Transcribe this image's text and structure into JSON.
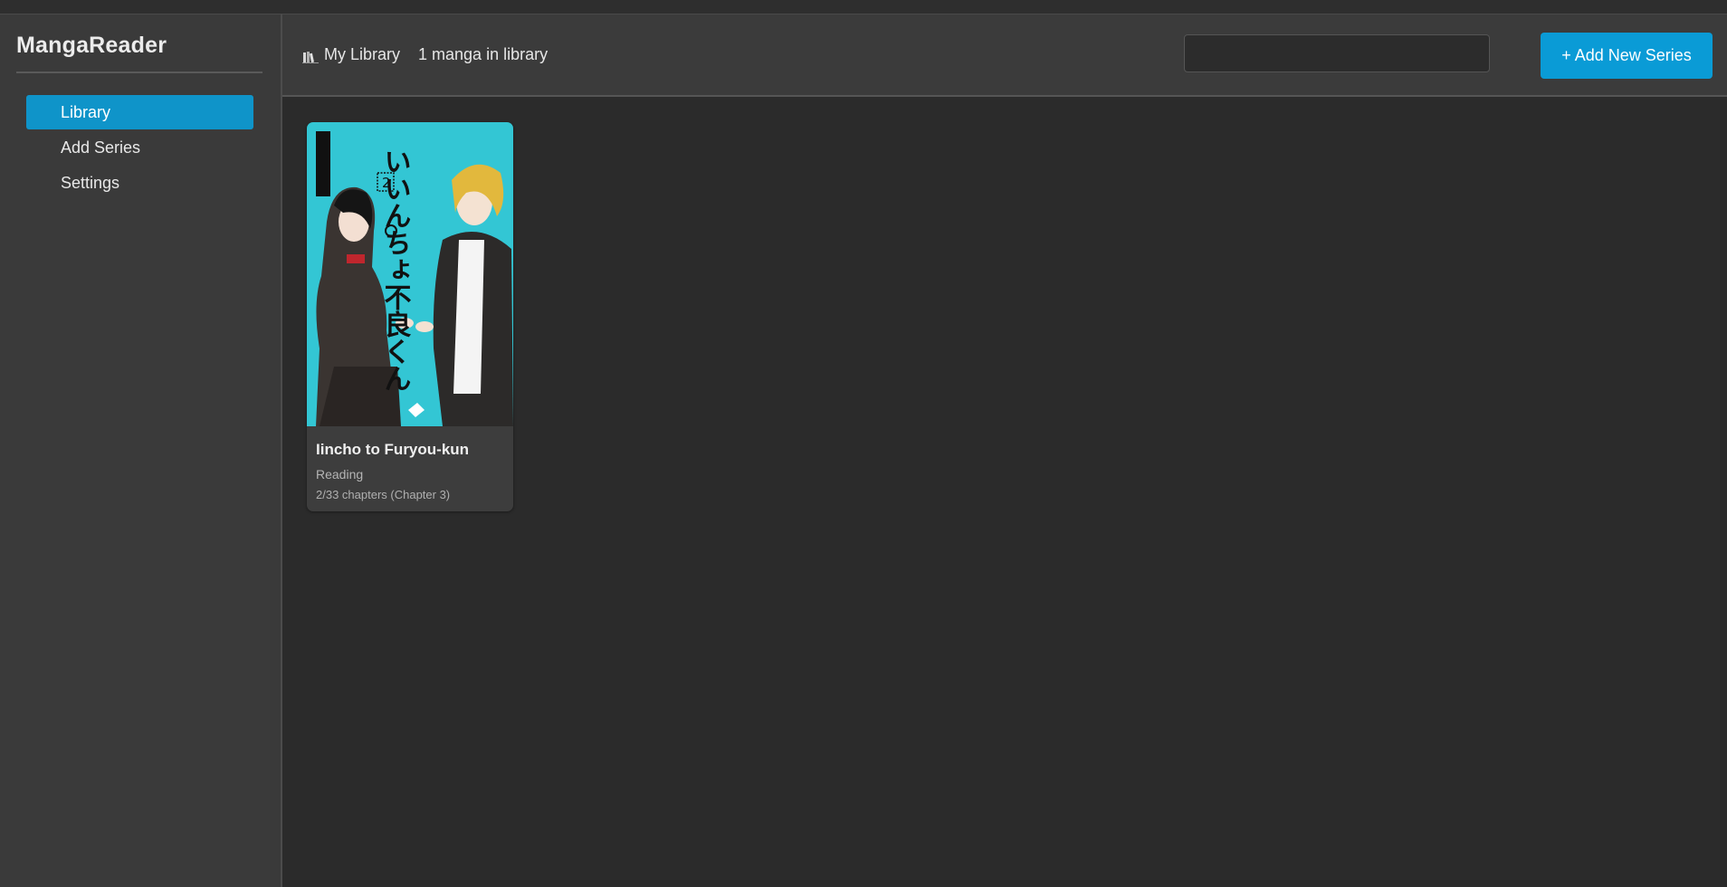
{
  "app": {
    "name": "MangaReader"
  },
  "sidebar": {
    "items": [
      {
        "label": "Library",
        "active": true
      },
      {
        "label": "Add Series",
        "active": false
      },
      {
        "label": "Settings",
        "active": false
      }
    ]
  },
  "header": {
    "title_icon": "books-icon",
    "title": "My Library",
    "count_text": "1 manga in library",
    "search": {
      "value": "",
      "placeholder": ""
    },
    "add_button_label": "+ Add New Series"
  },
  "library": {
    "items": [
      {
        "title": "Iincho to Furyou-kun",
        "status": "Reading",
        "progress": "2/33 chapters (Chapter 3)",
        "cover_text": "いいんちょ不良くん",
        "cover_volume": "2"
      }
    ]
  },
  "colors": {
    "accent": "#0a9bd6",
    "sidebar_bg": "#3a3a3a",
    "header_bg": "#3b3b3b",
    "content_bg": "#2b2b2b",
    "card_bg": "#3d3d3d",
    "cover_bg": "#33c6d4"
  }
}
